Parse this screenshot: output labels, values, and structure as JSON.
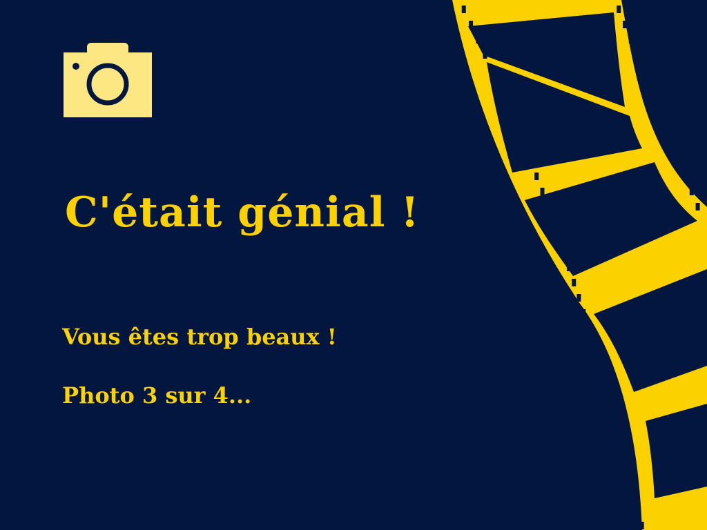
{
  "screen": {
    "headline": "C'était génial !",
    "compliment": "Vous êtes trop beaux !",
    "progress_text": "Photo 3 sur 4...",
    "progress": {
      "current": 3,
      "total": 4
    }
  },
  "icons": {
    "camera": "camera-icon",
    "film": "film-strip-icon"
  },
  "colors": {
    "background": "#021640",
    "accent": "#fcd100",
    "camera_body": "#fde783",
    "camera_detail": "#021640"
  }
}
